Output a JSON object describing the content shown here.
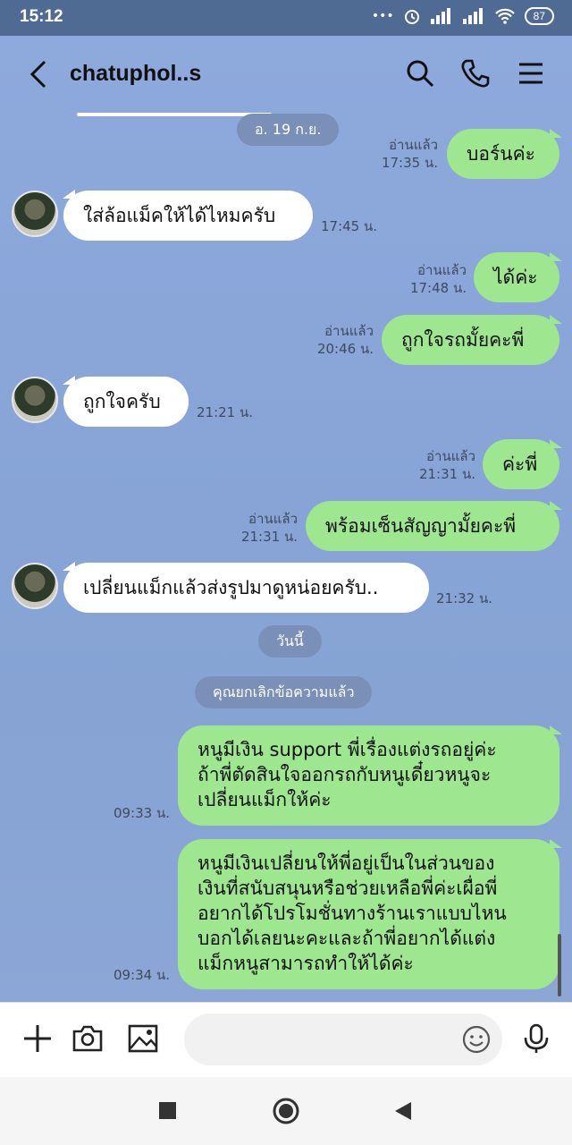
{
  "status": {
    "time": "15:12",
    "battery": "87"
  },
  "header": {
    "title": "chatuphol..s"
  },
  "dates": {
    "d1": "อ. 19 ก.ย.",
    "today": "วันนี้",
    "unsent": "คุณยกเลิกข้อความแล้ว"
  },
  "messages": [
    {
      "dir": "out",
      "text": [
        "บอร์นค่ะ"
      ],
      "read": "อ่านแล้ว",
      "time": "17:35 น."
    },
    {
      "dir": "in",
      "text": [
        "ใส่ล้อแม็คให้ได้ไหมครับ"
      ],
      "time": "17:45 น."
    },
    {
      "dir": "out",
      "text": [
        "ได้ค่ะ"
      ],
      "read": "อ่านแล้ว",
      "time": "17:48 น."
    },
    {
      "dir": "out",
      "text": [
        "ถูกใจรถมั้ยคะพี่"
      ],
      "read": "อ่านแล้ว",
      "time": "20:46 น."
    },
    {
      "dir": "in",
      "text": [
        "ถูกใจครับ"
      ],
      "time": "21:21 น."
    },
    {
      "dir": "out",
      "text": [
        "ค่ะพี่"
      ],
      "read": "อ่านแล้ว",
      "time": "21:31 น."
    },
    {
      "dir": "out",
      "text": [
        "พร้อมเซ็นสัญญามั้ยคะพี่"
      ],
      "read": "อ่านแล้ว",
      "time": "21:31 น."
    },
    {
      "dir": "in",
      "text": [
        "เปลี่ยนแม็กแล้วส่งรูปมาดูหน่อยครับ.."
      ],
      "time": "21:32 น."
    },
    {
      "dir": "out",
      "text": [
        "หนูมีเงิน support พี่เรื่องแต่งรถอยู่ค่ะ",
        "ถ้าพี่ตัดสินใจออกรถกับหนูเดี๋ยวหนูจะ",
        "เปลี่ยนแม็กให้ค่ะ"
      ],
      "time": "09:33 น."
    },
    {
      "dir": "out",
      "text": [
        "หนูมีเงินเปลี่ยนให้พี่อยู่เป็นในส่วนของ",
        "เงินที่สนับสนุนหรือช่วยเหลือพี่ค่ะเผื่อพี่",
        "อยากได้โปรโมชั่นทางร้านเราแบบไหน",
        "บอกได้เลยนะคะและถ้าพี่อยากได้แต่ง",
        "แม็กหนูสามารถทำให้ได้ค่ะ"
      ],
      "time": "09:34 น."
    }
  ],
  "colors": {
    "chat_bg": "#8aa5d6",
    "out_bubble": "#9ee68f",
    "in_bubble": "#ffffff",
    "status_bar": "#4f6b93"
  },
  "icons": [
    "back-icon",
    "search-icon",
    "phone-icon",
    "menu-icon",
    "plus-icon",
    "camera-icon",
    "image-icon",
    "emoji-icon",
    "mic-icon"
  ]
}
